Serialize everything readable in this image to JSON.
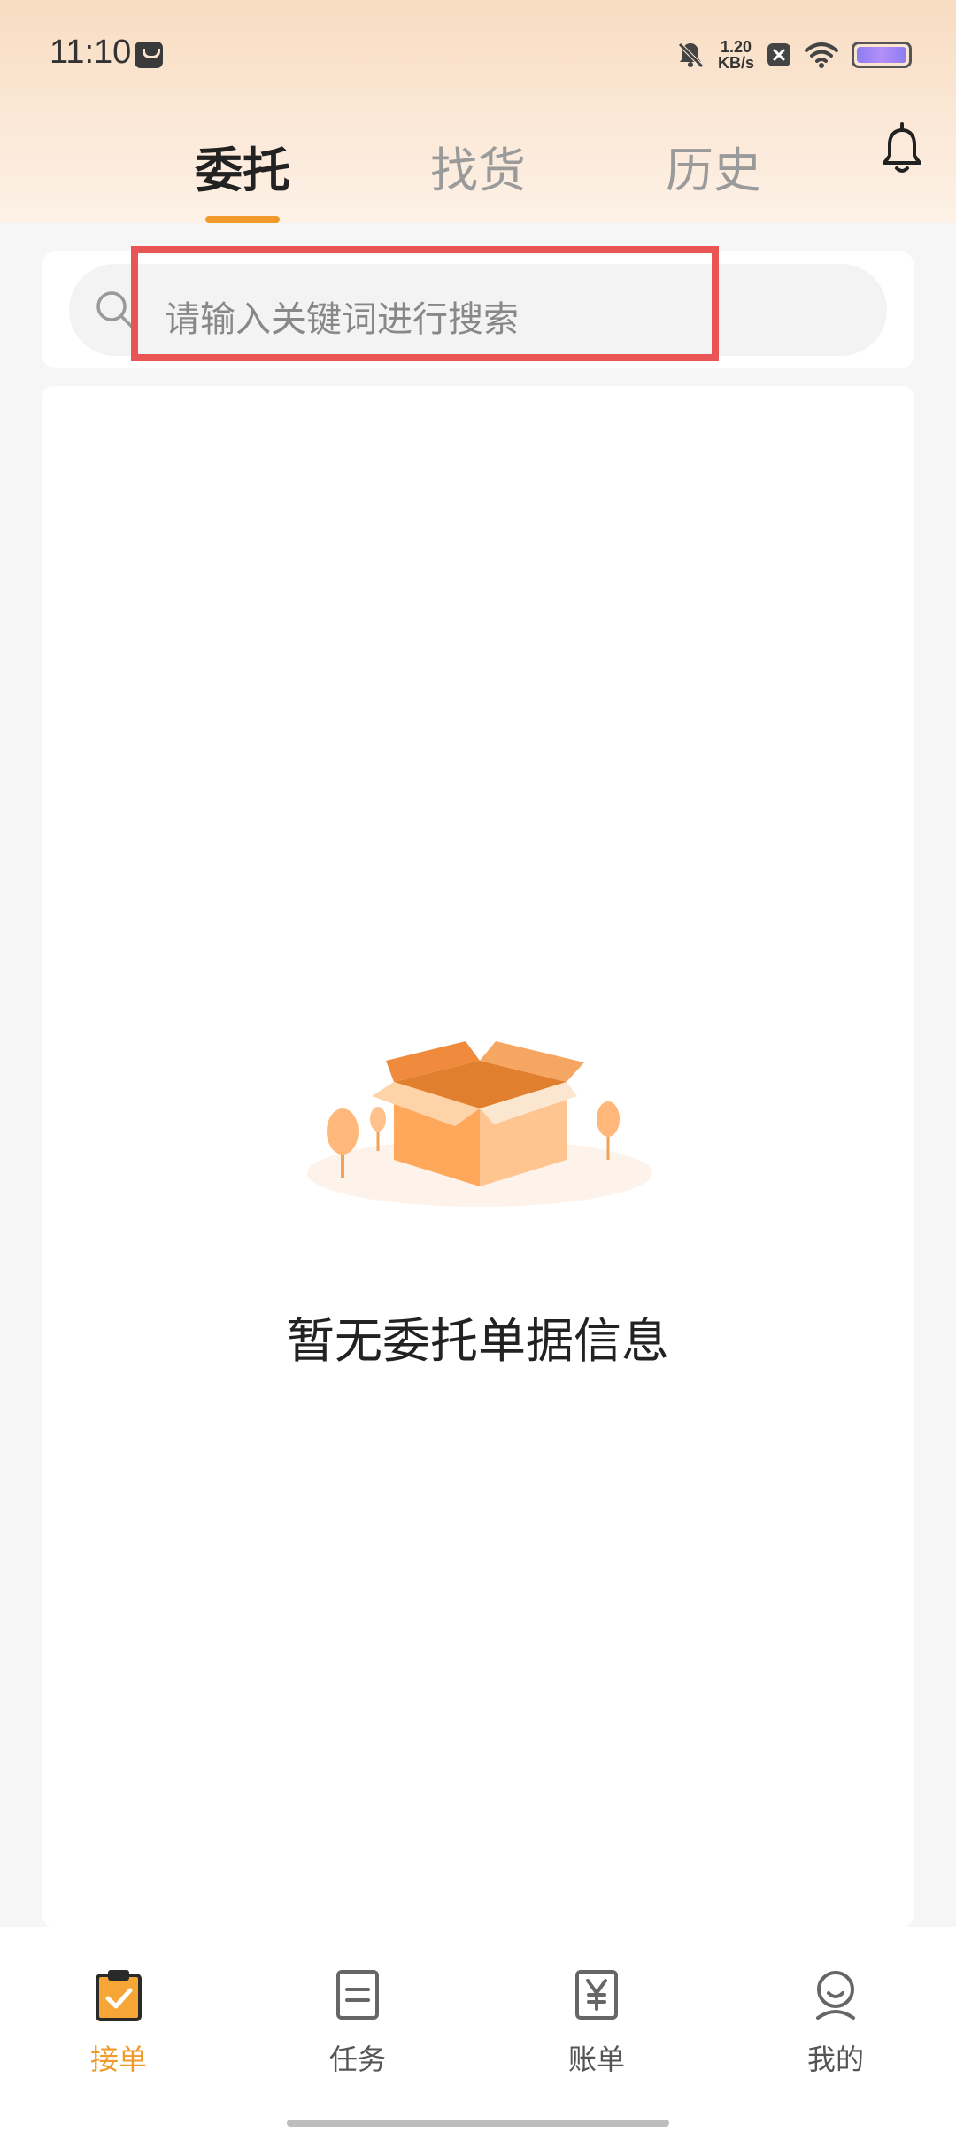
{
  "status_bar": {
    "time": "11:10",
    "network_speed_value": "1.20",
    "network_speed_unit": "KB/s",
    "icons": [
      "mute-bell-icon",
      "app-notification-icon",
      "close-badge-icon",
      "wifi-icon",
      "battery-icon"
    ]
  },
  "top_tabs": [
    {
      "label": "委托",
      "active": true
    },
    {
      "label": "找货",
      "active": false
    },
    {
      "label": "历史",
      "active": false
    }
  ],
  "search": {
    "placeholder": "请输入关键词进行搜索"
  },
  "empty_state": {
    "message": "暂无委托单据信息",
    "illustration": "open-box-illustration"
  },
  "bottom_nav": [
    {
      "label": "接单",
      "icon": "clipboard-check-icon",
      "active": true
    },
    {
      "label": "任务",
      "icon": "list-document-icon",
      "active": false
    },
    {
      "label": "账单",
      "icon": "yuan-bill-icon",
      "active": false
    },
    {
      "label": "我的",
      "icon": "user-profile-icon",
      "active": false
    }
  ],
  "colors": {
    "accent": "#f09a2b",
    "highlight_border": "#e85554",
    "header_gradient_top": "#f8dcc1"
  }
}
